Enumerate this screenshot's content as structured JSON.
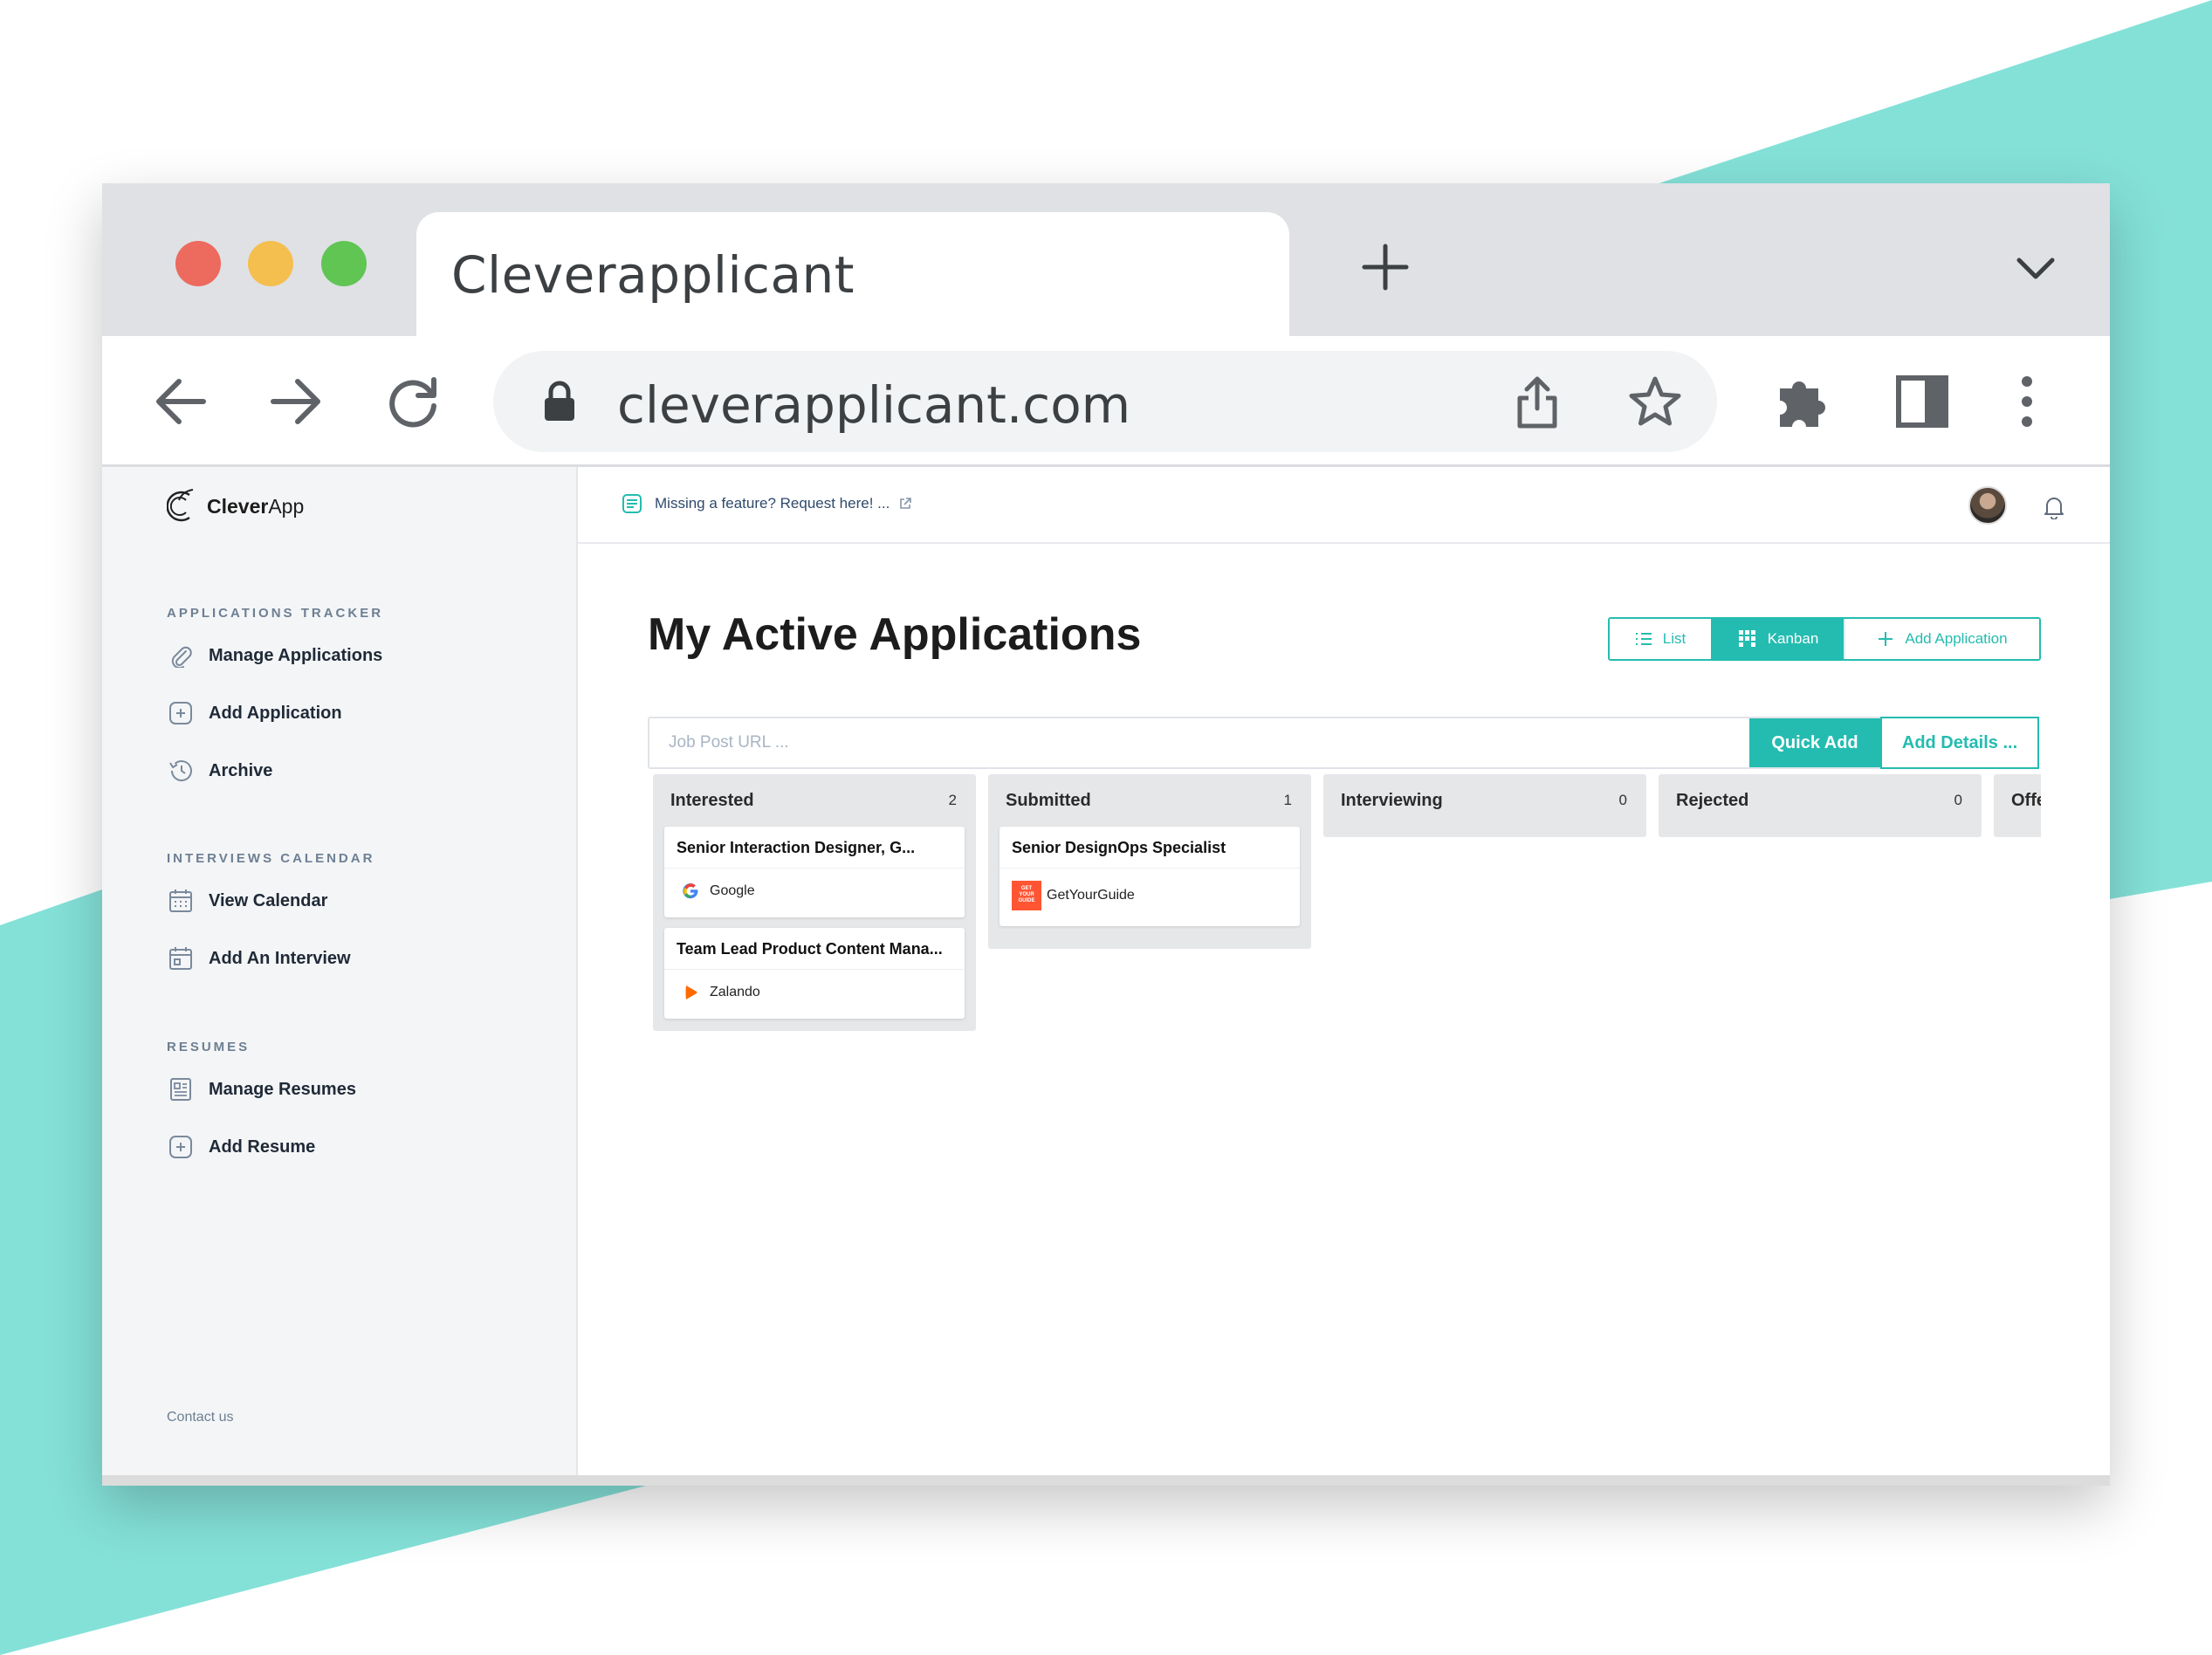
{
  "browser": {
    "tab_title": "Cleverapplicant",
    "url": "cleverapplicant.com"
  },
  "colors": {
    "accent": "#24bcb0",
    "background_decor": "#84e1d8",
    "sidebar_bg": "#f4f5f7",
    "column_bg": "#e6e7e9"
  },
  "sidebar": {
    "brand_bold": "Clever",
    "brand_rest": "App",
    "sections": [
      {
        "title": "APPLICATIONS TRACKER",
        "items": [
          {
            "label": "Manage Applications",
            "icon": "paperclip-icon"
          },
          {
            "label": "Add Application",
            "icon": "plus-square-icon"
          },
          {
            "label": "Archive",
            "icon": "history-icon"
          }
        ]
      },
      {
        "title": "INTERVIEWS CALENDAR",
        "items": [
          {
            "label": "View Calendar",
            "icon": "calendar-icon"
          },
          {
            "label": "Add An Interview",
            "icon": "calendar-add-icon"
          }
        ]
      },
      {
        "title": "RESUMES",
        "items": [
          {
            "label": "Manage Resumes",
            "icon": "resume-icon"
          },
          {
            "label": "Add Resume",
            "icon": "plus-square-icon"
          }
        ]
      }
    ],
    "contact": "Contact us"
  },
  "topbar": {
    "feature_request": "Missing a feature? Request here! ..."
  },
  "main": {
    "title": "My Active Applications",
    "view_toggle": {
      "list": "List",
      "kanban": "Kanban",
      "add": "Add Application",
      "active": "Kanban"
    },
    "quick_add": {
      "placeholder": "Job Post URL ...",
      "quick_add_label": "Quick Add",
      "add_details_label": "Add Details ..."
    }
  },
  "board": {
    "columns": [
      {
        "title": "Interested",
        "count": "2",
        "cards": [
          {
            "title": "Senior Interaction Designer, G...",
            "company": "Google"
          },
          {
            "title": "Team Lead Product Content Mana...",
            "company": "Zalando"
          }
        ]
      },
      {
        "title": "Submitted",
        "count": "1",
        "cards": [
          {
            "title": "Senior DesignOps Specialist",
            "company": "GetYourGuide",
            "logo_text": "GET YOUR GUIDE"
          }
        ]
      },
      {
        "title": "Interviewing",
        "count": "0",
        "cards": []
      },
      {
        "title": "Rejected",
        "count": "0",
        "cards": []
      },
      {
        "title": "Offe",
        "count": "",
        "cards": []
      }
    ]
  }
}
